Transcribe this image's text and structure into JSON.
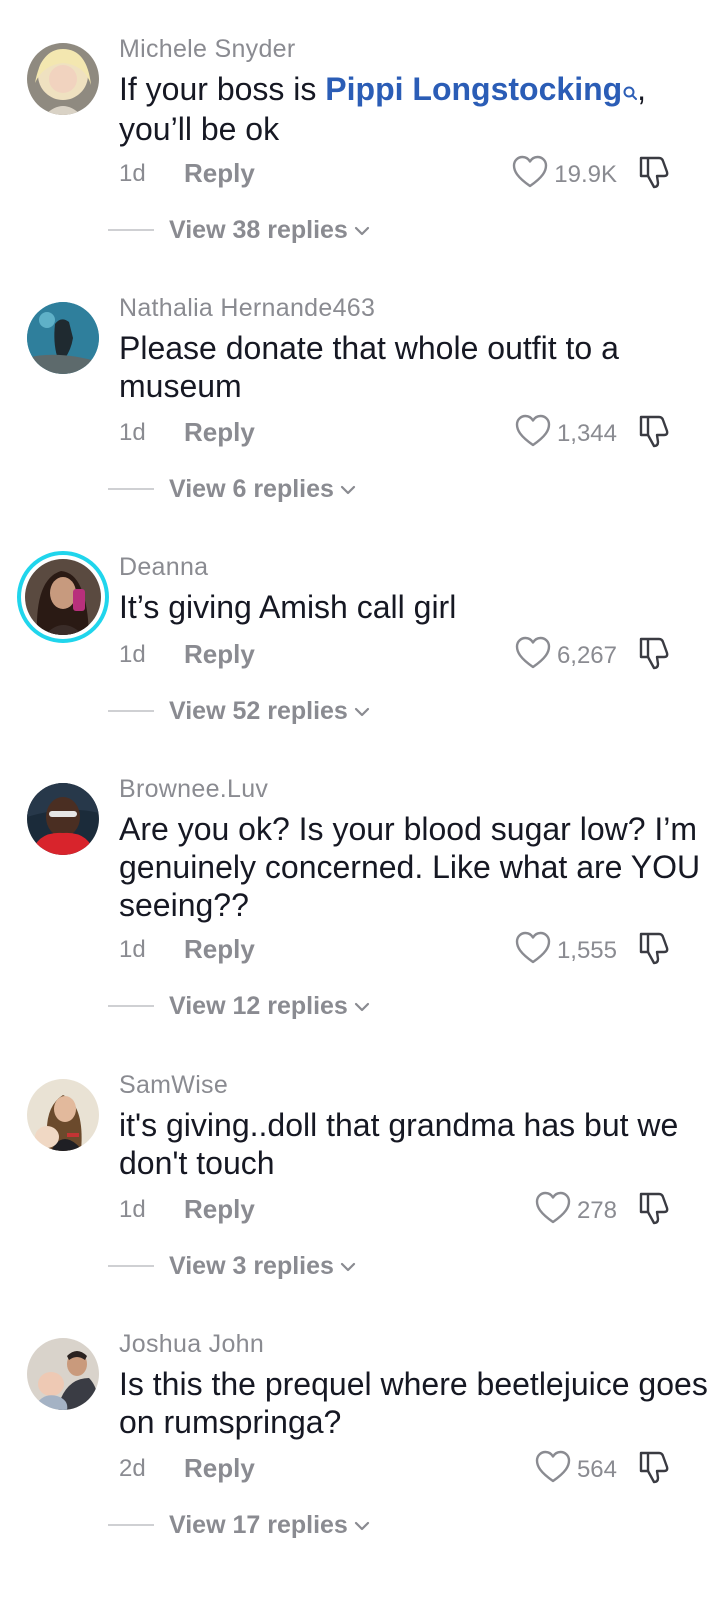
{
  "colors": {
    "username": "#8a8b91",
    "body_text": "#161823",
    "link": "#2b5db6",
    "story_ring": "#20d5ec"
  },
  "icons": {
    "like": "heart-outline-icon",
    "dislike": "thumbs-down-icon",
    "expand": "chevron-down-icon",
    "link_search": "search-icon"
  },
  "comments": [
    {
      "username": "Michele Snyder",
      "text_before_link": "If your boss is ",
      "link_text": "Pippi Longstocking",
      "text_after_link": ", you’ll be ok",
      "date": "1d",
      "reply_label": "Reply",
      "likes": "19.9K",
      "view_replies": "View 38 replies"
    },
    {
      "username": "Nathalia Hernande463",
      "text": "Please donate that whole outfit to a museum",
      "date": "1d",
      "reply_label": "Reply",
      "likes": "1,344",
      "view_replies": "View 6 replies"
    },
    {
      "username": "Deanna",
      "text": "It’s giving Amish call girl",
      "date": "1d",
      "reply_label": "Reply",
      "likes": "6,267",
      "view_replies": "View 52 replies"
    },
    {
      "username": "Brownee.Luv",
      "text": "Are you ok? Is your blood sugar low? I’m genuinely concerned. Like what are YOU seeing??",
      "date": "1d",
      "reply_label": "Reply",
      "likes": "1,555",
      "view_replies": "View 12 replies"
    },
    {
      "username": "SamWise",
      "text": "it's giving..doll that grandma has but we don't touch",
      "date": "1d",
      "reply_label": "Reply",
      "likes": "278",
      "view_replies": "View 3 replies"
    },
    {
      "username": "Joshua John",
      "text": "Is this the prequel where beetlejuice goes on rumspringa?",
      "date": "2d",
      "reply_label": "Reply",
      "likes": "564",
      "view_replies": "View 17 replies"
    }
  ]
}
